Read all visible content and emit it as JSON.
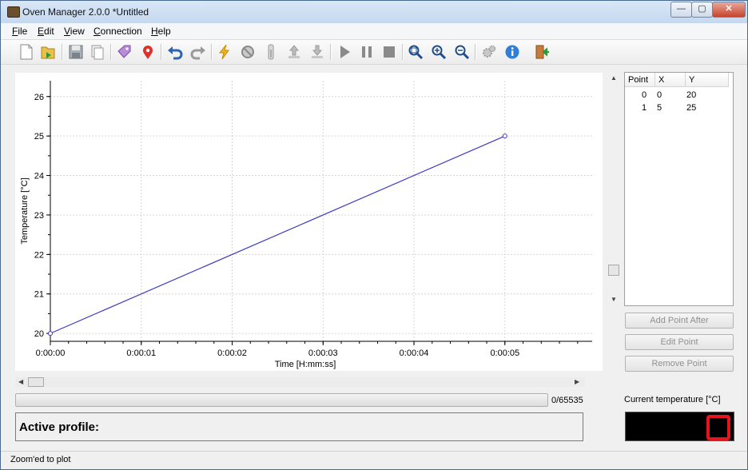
{
  "window": {
    "title": "Oven Manager 2.0.0 *Untitled",
    "min": "—",
    "max": "▢",
    "close": "✕"
  },
  "menu": [
    {
      "key": "F",
      "rest": "ile"
    },
    {
      "key": "E",
      "rest": "dit"
    },
    {
      "key": "V",
      "rest": "iew"
    },
    {
      "key": "C",
      "rest": "onnection"
    },
    {
      "key": "H",
      "rest": "elp"
    }
  ],
  "toolbar_icons": [
    "new-file-icon",
    "open-file-icon",
    "save-icon",
    "copy-icon",
    "tag-icon",
    "location-pin-icon",
    "undo-icon",
    "redo-icon",
    "lightning-icon",
    "stop-circle-icon",
    "thermometer-icon",
    "upload-icon",
    "download-icon",
    "play-icon",
    "pause-icon",
    "stop-icon",
    "zoom-fit-icon",
    "zoom-in-icon",
    "zoom-out-icon",
    "settings-icon",
    "info-icon",
    "exit-icon"
  ],
  "chart_data": {
    "type": "line",
    "x": [
      0,
      5
    ],
    "y": [
      20,
      25
    ],
    "x_tick_labels": [
      "0:00:00",
      "0:00:01",
      "0:00:02",
      "0:00:03",
      "0:00:04",
      "0:00:05"
    ],
    "y_tick_labels": [
      "20",
      "21",
      "22",
      "23",
      "24",
      "25",
      "26"
    ],
    "xlabel": "Time [H:mm:ss]",
    "ylabel": "Temperature [°C]",
    "xlim": [
      0,
      5.96
    ],
    "ylim": [
      19.8,
      26.4
    ],
    "grid": true,
    "line_color": "#3a3ac0"
  },
  "table": {
    "headers": [
      "Point",
      "X",
      "Y"
    ],
    "rows": [
      [
        "0",
        "0",
        "20"
      ],
      [
        "1",
        "5",
        "25"
      ]
    ]
  },
  "buttons": {
    "add_point_after": "Add Point After",
    "edit_point": "Edit Point",
    "remove_point": "Remove Point"
  },
  "progress": {
    "value": 0,
    "max": 65535,
    "text": "0/65535"
  },
  "profile": {
    "label": "Active profile:"
  },
  "temperature": {
    "label": "Current temperature [°C]",
    "value": "0",
    "digit_color": "#e8141c"
  },
  "status": {
    "text": "Zoom'ed to plot"
  }
}
